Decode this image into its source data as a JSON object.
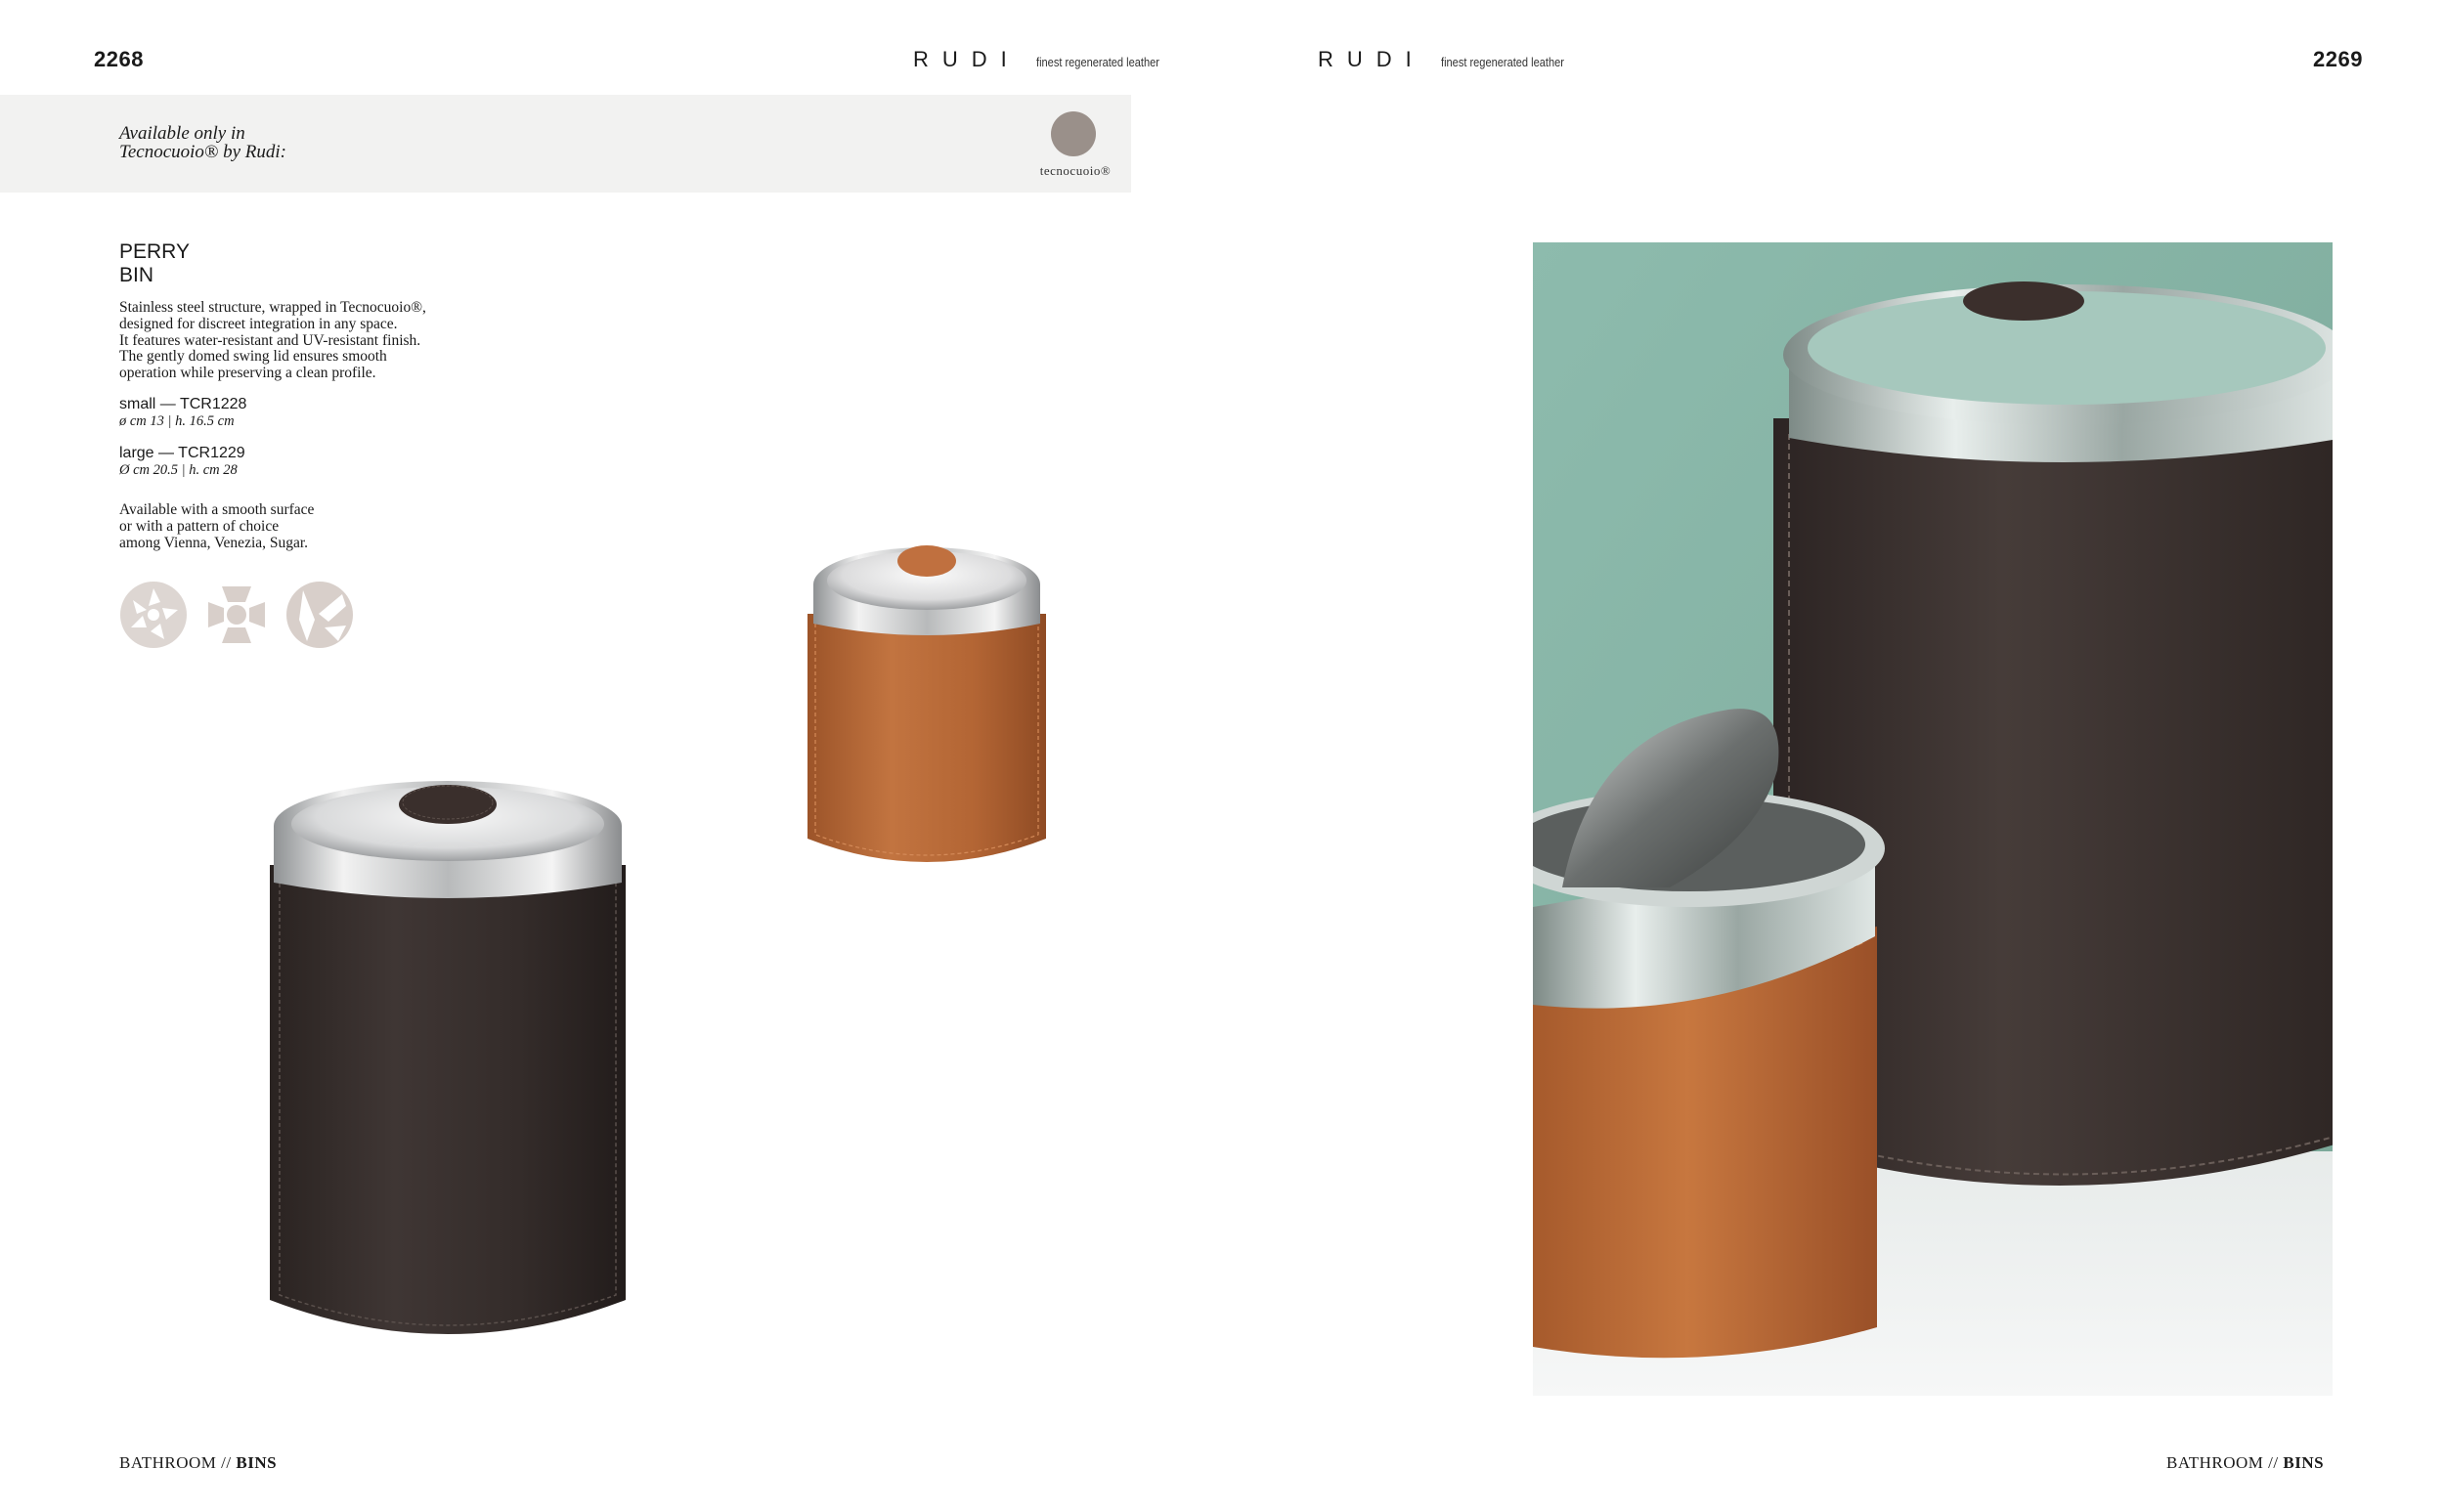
{
  "header": {
    "left_page_number": "2268",
    "right_page_number": "2269",
    "brand_name": "RUDI",
    "brand_tagline": "finest regenerated leather"
  },
  "availability": {
    "line1": "Available only in",
    "line2": "Tecnocuoio® by Rudi:",
    "material_label": "tecnocuoio®",
    "material_color": "#9a908a"
  },
  "product": {
    "title_line1": "PERRY",
    "title_line2": "BIN",
    "description": [
      "Stainless steel structure, wrapped in Tecnocuoio®,",
      "designed for discreet integration in any space.",
      "It features water-resistant and UV-resistant finish.",
      "The gently domed swing lid ensures smooth",
      "operation while preserving a clean profile."
    ],
    "variants": [
      {
        "code": "small — TCR1228",
        "dimensions": "ø cm 13 | h. 16.5 cm"
      },
      {
        "code": "large — TCR1229",
        "dimensions": "Ø cm 20.5 | h. cm 28"
      }
    ],
    "finish_note": [
      "Available with a smooth surface",
      "or with a pattern of choice",
      "among Vienna, Venezia, Sugar."
    ],
    "patterns": [
      "Vienna",
      "Venezia",
      "Sugar"
    ],
    "colors": {
      "dark_brown": "#3b3230",
      "tan": "#b9693a",
      "photo_background": "#8fb5a8"
    }
  },
  "footer": {
    "left_section": "BATHROOM //",
    "left_category": "BINS",
    "right_section": "BATHROOM //",
    "right_category": "BINS"
  }
}
